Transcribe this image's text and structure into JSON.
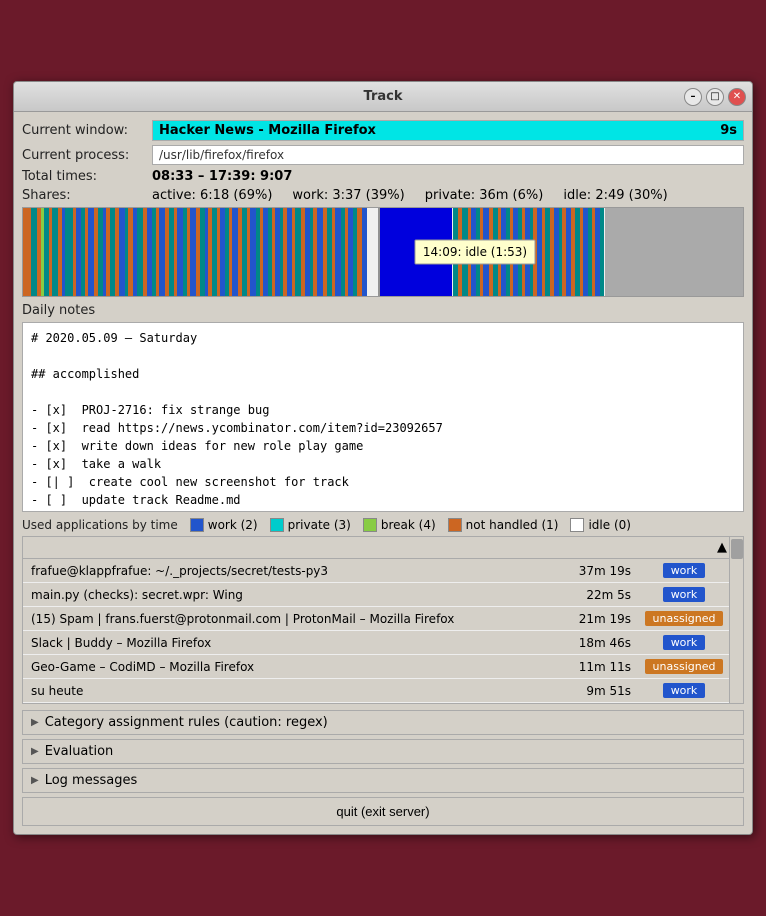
{
  "window": {
    "title": "Track",
    "buttons": {
      "minimize": "–",
      "maximize": "□",
      "close": "✕"
    }
  },
  "info": {
    "current_window_label": "Current window:",
    "current_window_value": "Hacker News - Mozilla Firefox",
    "current_window_time": "9s",
    "current_process_label": "Current process:",
    "current_process_value": "/usr/lib/firefox/firefox",
    "total_times_label": "Total times:",
    "total_times_value": "08:33 – 17:39: 9:07",
    "shares_label": "Shares:",
    "shares_active": "active: 6:18 (69%)",
    "shares_work": "work: 3:37 (39%)",
    "shares_private": "private: 36m (6%)",
    "shares_idle": "idle: 2:49 (30%)"
  },
  "timeline": {
    "tooltip": "14:09: idle (1:53)"
  },
  "daily_notes": {
    "label": "Daily notes",
    "text": "# 2020.05.09 – Saturday\n\n## accomplished\n\n- [x]  PROJ-2716: fix strange bug\n- [x]  read https://news.ycombinator.com/item?id=23092657\n- [x]  write down ideas for new role play game\n- [x]  take a walk\n- [| ]  create cool new screenshot for track\n- [ ]  update track Readme.md"
  },
  "legend": {
    "label": "Used applications by time",
    "items": [
      {
        "color": "#2255cc",
        "label": "work (2)"
      },
      {
        "color": "#00cccc",
        "label": "private (3)"
      },
      {
        "color": "#88cc44",
        "label": "break (4)"
      },
      {
        "color": "#cc6622",
        "label": "not handled (1)"
      },
      {
        "color": "#ffffff",
        "label": "idle (0)"
      }
    ]
  },
  "applications": [
    {
      "name": "frafue@klappfrafue: ~/._projects/secret/tests-py3",
      "time": "37m 19s",
      "tag": "work",
      "tag_type": "work"
    },
    {
      "name": "main.py (checks): secret.wpr: Wing",
      "time": "22m 5s",
      "tag": "work",
      "tag_type": "work"
    },
    {
      "name": "(15) Spam | frans.fuerst@protonmail.com | ProtonMail – Mozilla Firefox",
      "time": "21m 19s",
      "tag": "unassigned",
      "tag_type": "unassigned"
    },
    {
      "name": "Slack | Buddy – Mozilla Firefox",
      "time": "18m 46s",
      "tag": "work",
      "tag_type": "work"
    },
    {
      "name": "Geo-Game – CodiMD – Mozilla Firefox",
      "time": "11m 11s",
      "tag": "unassigned",
      "tag_type": "unassigned"
    },
    {
      "name": "su heute",
      "time": "9m 51s",
      "tag": "work",
      "tag_type": "work"
    }
  ],
  "collapsible": [
    {
      "label": "Category assignment rules (caution: regex)"
    },
    {
      "label": "Evaluation"
    },
    {
      "label": "Log messages"
    }
  ],
  "quit_button": "quit (exit server)"
}
